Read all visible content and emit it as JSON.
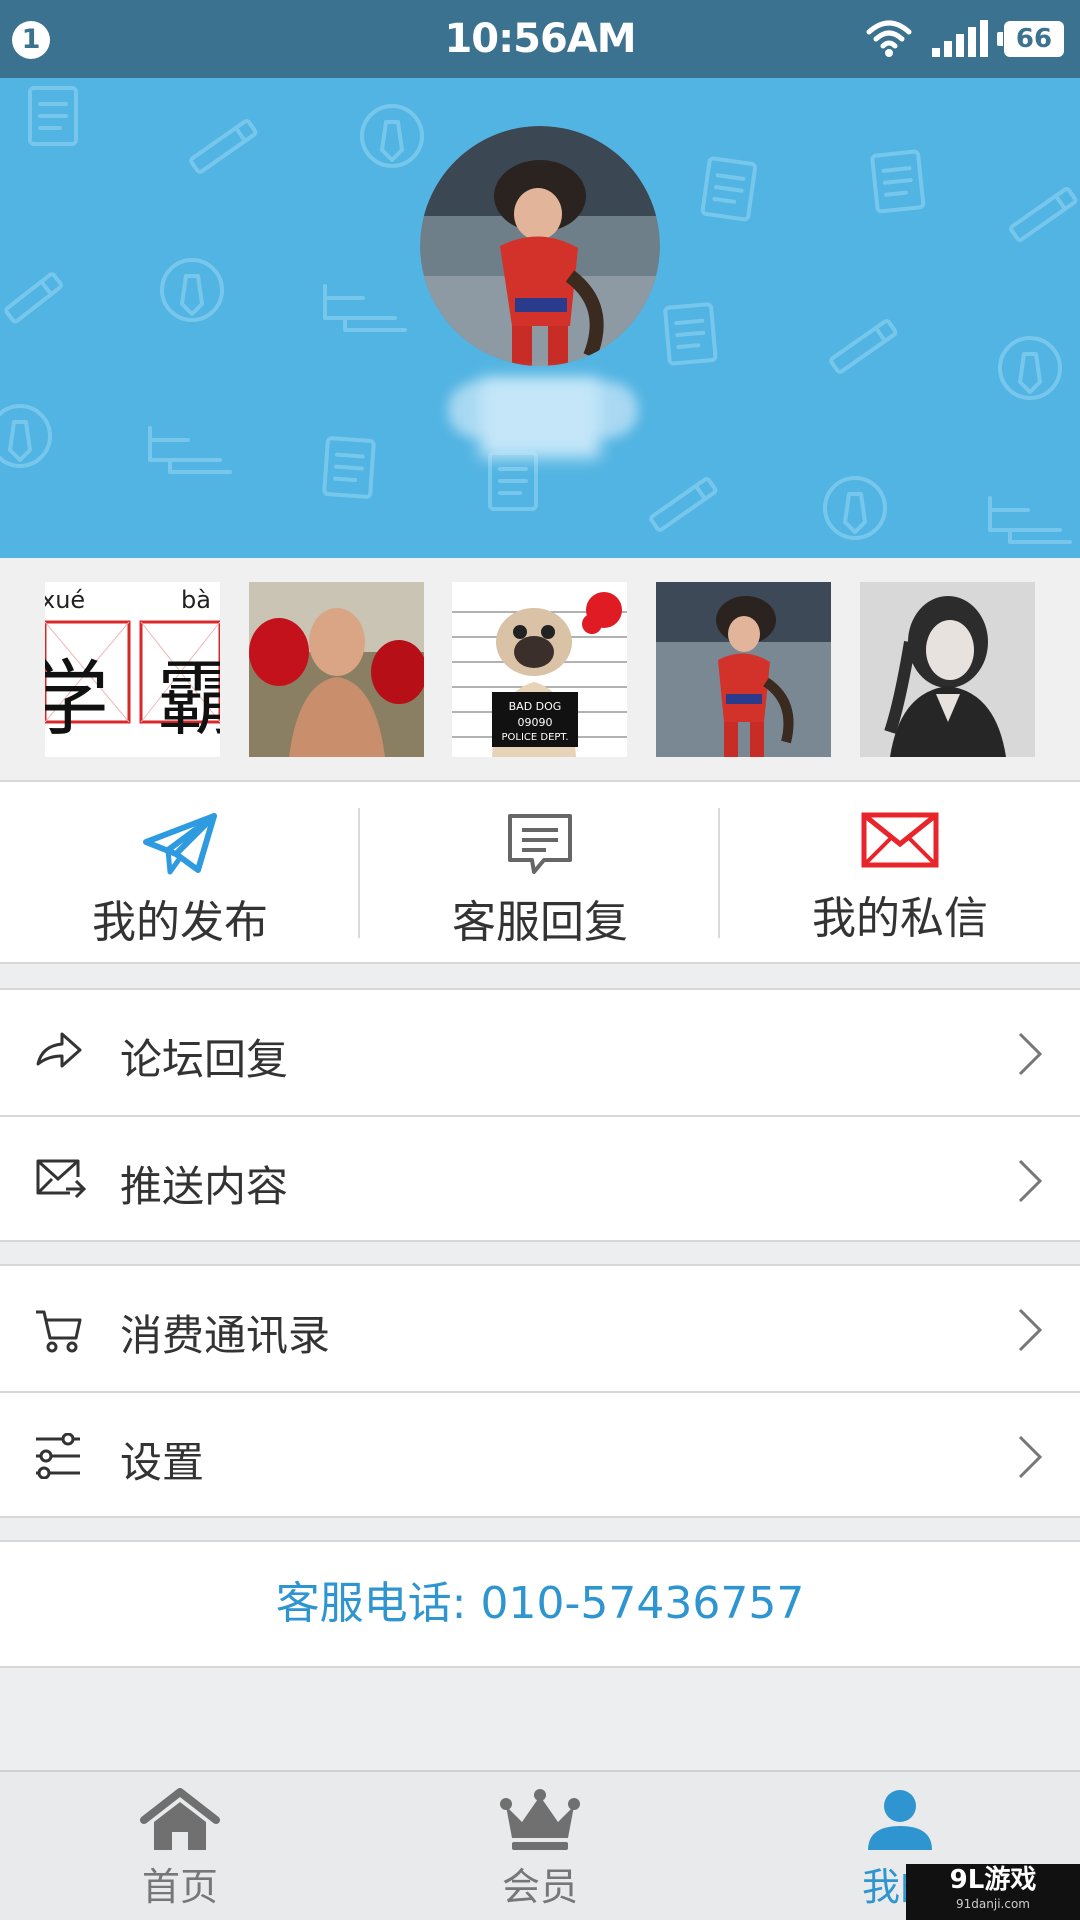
{
  "status_bar": {
    "notification_count": "1",
    "time": "10:56AM",
    "battery": "66"
  },
  "profile": {
    "avatar_icon": "child-costume-photo",
    "username": ""
  },
  "photos": [
    {
      "name": "xue-ba-photo",
      "pinyin_left": "xué",
      "pinyin_right": "bà",
      "char_left": "学",
      "char_right": "霸"
    },
    {
      "name": "boxer-photo"
    },
    {
      "name": "pug-photo",
      "sign_line1": "BAD DOG",
      "sign_line2": "09090",
      "sign_line3": "POLICE DEPT."
    },
    {
      "name": "child-costume-photo"
    },
    {
      "name": "girl-portrait-photo"
    }
  ],
  "quick_actions": [
    {
      "label": "我的发布",
      "icon": "paper-plane-icon",
      "color": "#2e9be0"
    },
    {
      "label": "客服回复",
      "icon": "message-icon",
      "color": "#666666"
    },
    {
      "label": "我的私信",
      "icon": "envelope-icon",
      "color": "#e8252a"
    }
  ],
  "menu_groups": [
    [
      {
        "label": "论坛回复",
        "icon": "reply-arrow-icon"
      },
      {
        "label": "推送内容",
        "icon": "mail-forward-icon"
      }
    ],
    [
      {
        "label": "消费通讯录",
        "icon": "cart-icon"
      },
      {
        "label": "设置",
        "icon": "sliders-icon"
      }
    ]
  ],
  "hotline": "客服电话: 010-57436757",
  "tabs": [
    {
      "label": "首页",
      "icon": "home-icon",
      "active": false
    },
    {
      "label": "会员",
      "icon": "crown-icon",
      "active": false
    },
    {
      "label": "我的",
      "icon": "person-icon",
      "active": true
    }
  ],
  "watermark": {
    "logo": "9L游戏",
    "url": "91danji.com"
  },
  "colors": {
    "status_bar": "#3a7290",
    "header": "#52b4e2",
    "accent": "#2e95d0",
    "background": "#edeef0"
  }
}
